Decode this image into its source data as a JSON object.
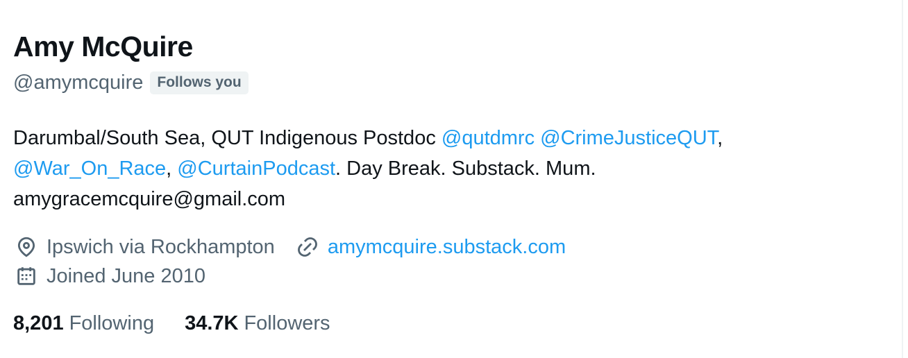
{
  "profile": {
    "name": "Amy McQuire",
    "handle": "@amymcquire",
    "follows_you": "Follows you",
    "bio": {
      "text1": "Darumbal/South Sea, QUT Indigenous Postdoc ",
      "mention1": "@qutdmrc",
      "space1": " ",
      "mention2": "@CrimeJusticeQUT",
      "comma1": ",",
      "mention3": "@War_On_Race",
      "comma2": ", ",
      "mention4": "@CurtainPodcast",
      "text2": ". Day Break. Substack. Mum.",
      "email": "amygracemcquire@gmail.com"
    },
    "location": "Ipswich via Rockhampton",
    "website": "amymcquire.substack.com",
    "joined": "Joined June 2010",
    "following_count": "8,201",
    "following_label": "Following",
    "followers_count": "34.7K",
    "followers_label": "Followers"
  },
  "icons": {
    "location": "location-pin-icon",
    "website": "link-icon",
    "joined": "calendar-icon"
  },
  "colors": {
    "text_primary": "#0f1419",
    "text_secondary": "#536471",
    "link": "#1d9bf0",
    "badge_bg": "#eff3f4"
  }
}
